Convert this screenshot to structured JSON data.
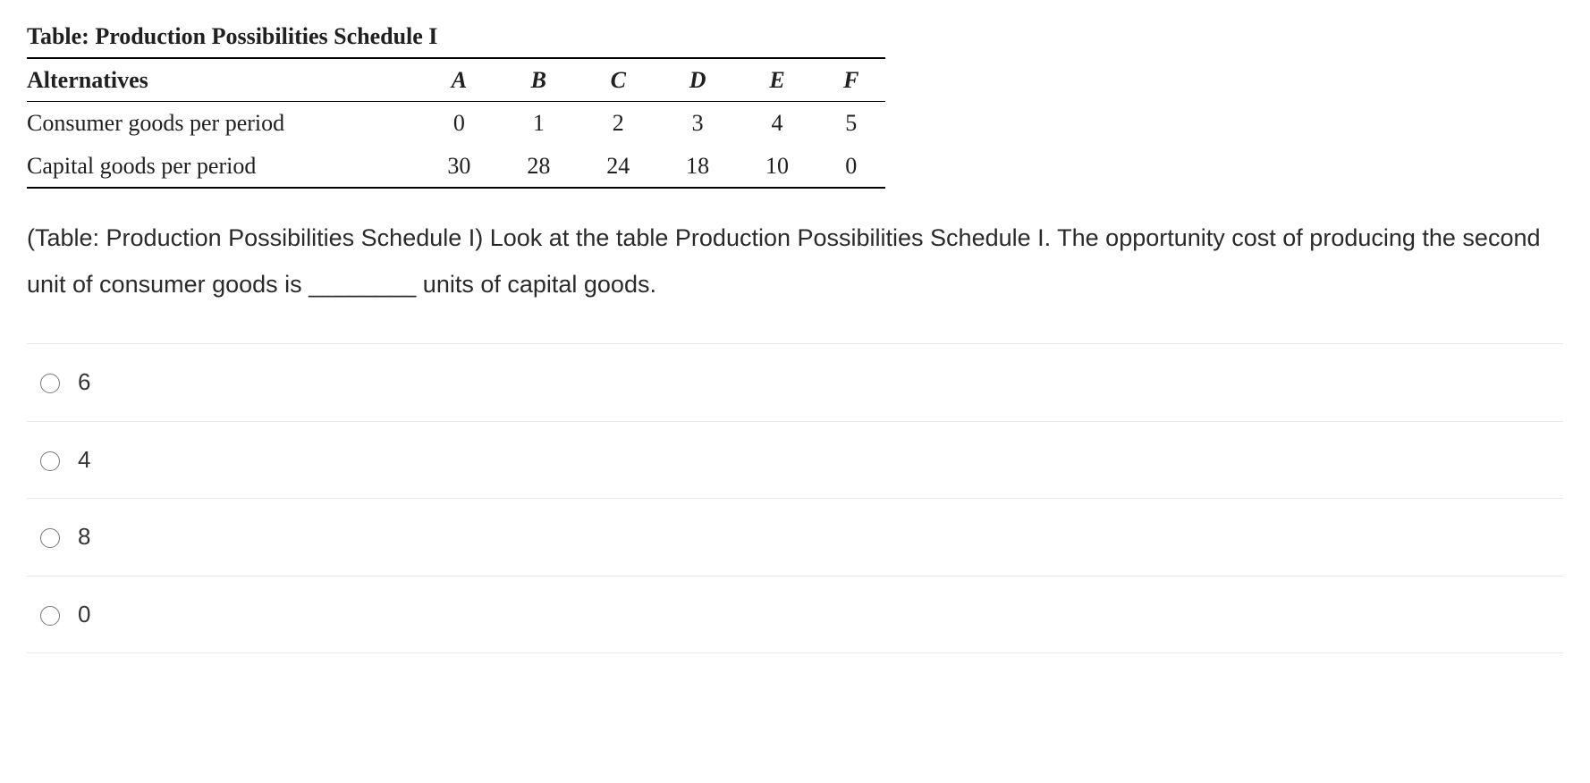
{
  "table": {
    "title": "Table: Production Possibilities Schedule I",
    "colHeader0": "Alternatives",
    "cols": [
      "A",
      "B",
      "C",
      "D",
      "E",
      "F"
    ],
    "rows": [
      {
        "label": "Consumer goods per period",
        "values": [
          "0",
          "1",
          "2",
          "3",
          "4",
          "5"
        ]
      },
      {
        "label": "Capital goods per period",
        "values": [
          "30",
          "28",
          "24",
          "18",
          "10",
          "0"
        ]
      }
    ]
  },
  "question": "(Table: Production Possibilities Schedule I) Look at the table Production Possibilities Schedule I. The opportunity cost of producing the second unit of consumer goods is ________ units of capital goods.",
  "options": [
    "6",
    "4",
    "8",
    "0"
  ],
  "chart_data": {
    "type": "table",
    "title": "Production Possibilities Schedule I",
    "categories": [
      "A",
      "B",
      "C",
      "D",
      "E",
      "F"
    ],
    "series": [
      {
        "name": "Consumer goods per period",
        "values": [
          0,
          1,
          2,
          3,
          4,
          5
        ]
      },
      {
        "name": "Capital goods per period",
        "values": [
          30,
          28,
          24,
          18,
          10,
          0
        ]
      }
    ]
  }
}
